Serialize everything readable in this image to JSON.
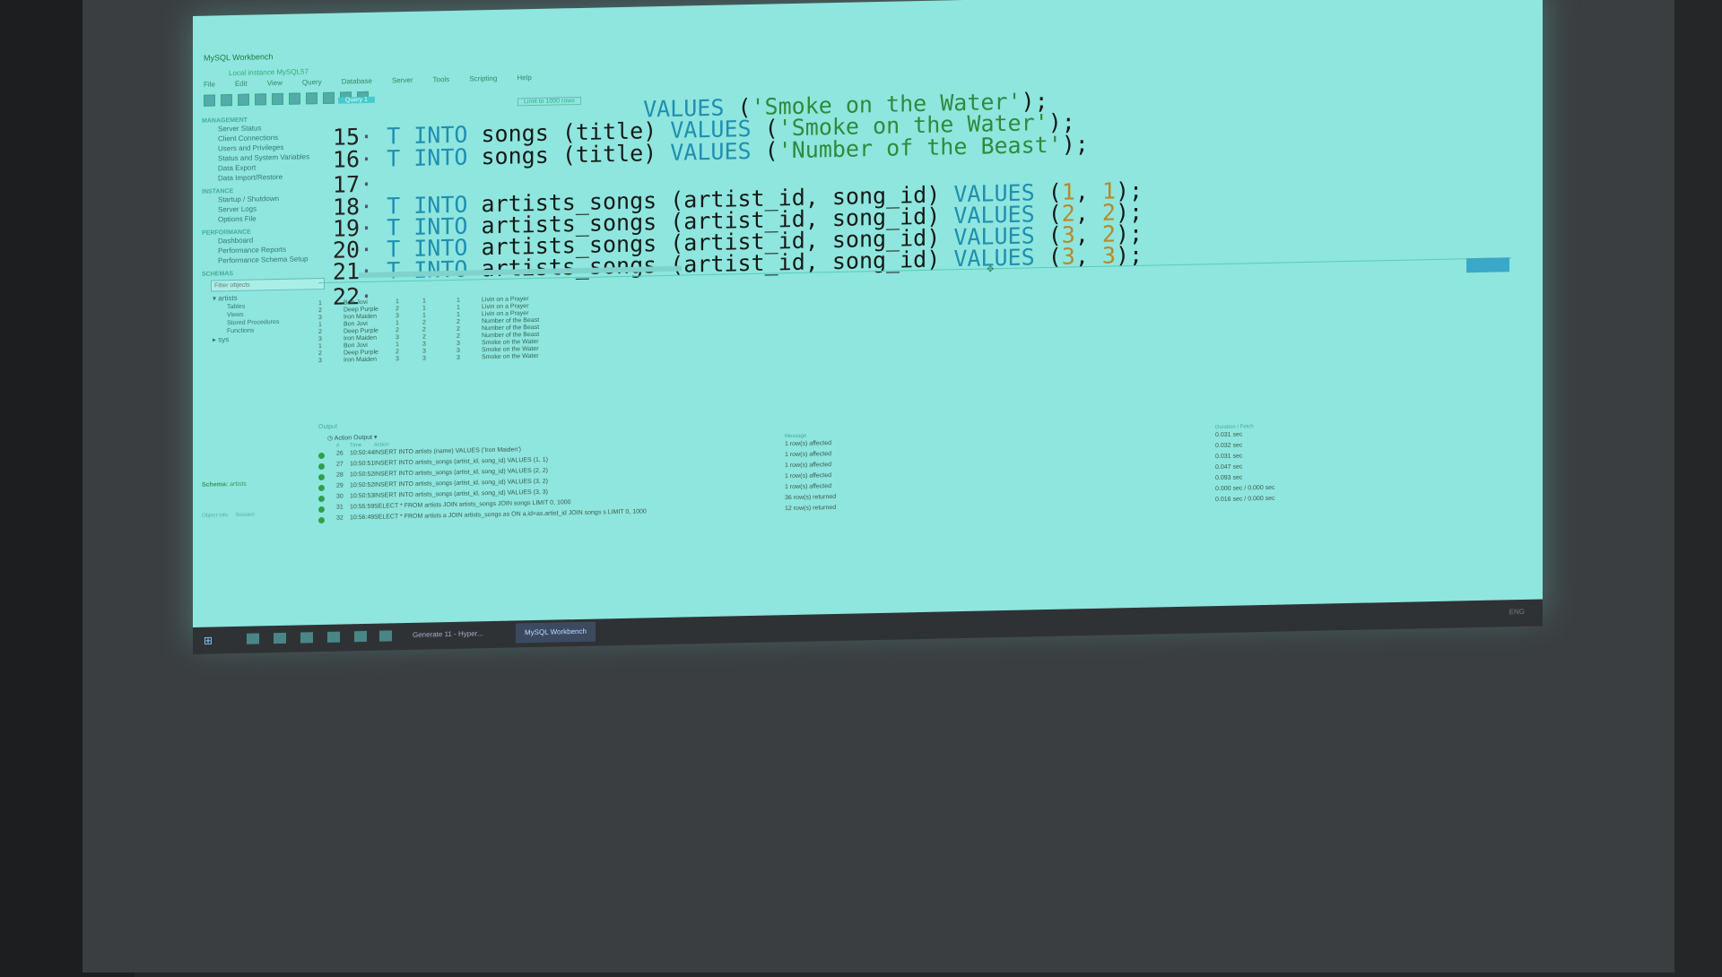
{
  "window": {
    "title": "MySQL Workbench",
    "connection_tab": "Local instance MySQL57",
    "controls": [
      "—",
      "□",
      "✕"
    ]
  },
  "menu": [
    "File",
    "Edit",
    "View",
    "Query",
    "Database",
    "Server",
    "Tools",
    "Scripting",
    "Help"
  ],
  "navigator": {
    "management_header": "MANAGEMENT",
    "management_items": [
      "Server Status",
      "Client Connections",
      "Users and Privileges",
      "Status and System Variables",
      "Data Export",
      "Data Import/Restore"
    ],
    "instance_header": "INSTANCE",
    "instance_items": [
      "Startup / Shutdown",
      "Server Logs",
      "Options File"
    ],
    "performance_header": "PERFORMANCE",
    "performance_items": [
      "Dashboard",
      "Performance Reports",
      "Performance Schema Setup"
    ],
    "schemas_header": "SCHEMAS",
    "filter_placeholder": "Filter objects",
    "schema_name": "artists",
    "schema_children": [
      "Tables",
      "Views",
      "Stored Procedures",
      "Functions"
    ],
    "other_schema": "sys",
    "schema_label": "Schema:",
    "schema_value": "artists"
  },
  "editor": {
    "tab": "Query 1",
    "limit": "Limit to 1000 rows",
    "lines": [
      {
        "no": "",
        "head": "",
        "table": "",
        "cols": "",
        "values_kw": "VALUES",
        "args": [
          "'Smoke on the Water'"
        ],
        "tail": ");"
      },
      {
        "no": "15",
        "head": "T INTO",
        "table": "songs",
        "cols": "(title)",
        "values_kw": "VALUES",
        "args": [
          "'Smoke on the Water'"
        ],
        "tail": ");"
      },
      {
        "no": "16",
        "head": "T INTO",
        "table": "songs",
        "cols": "(title)",
        "values_kw": "VALUES",
        "args": [
          "'Number of the Beast'"
        ],
        "tail": ");"
      },
      {
        "no": "17"
      },
      {
        "no": "18",
        "head": "T INTO",
        "table": "artists_songs",
        "cols": "(artist_id, song_id)",
        "values_kw": "VALUES",
        "a": "1",
        "b": "1"
      },
      {
        "no": "19",
        "head": "T INTO",
        "table": "artists_songs",
        "cols": "(artist_id, song_id)",
        "values_kw": "VALUES",
        "a": "2",
        "b": "2"
      },
      {
        "no": "20",
        "head": "T INTO",
        "table": "artists_songs",
        "cols": "(artist_id, song_id)",
        "values_kw": "VALUES",
        "a": "3",
        "b": "2"
      },
      {
        "no": "21",
        "head": "T INTO",
        "table": "artists_songs",
        "cols": "(artist_id, song_id)",
        "values_kw": "VALUES",
        "a": "3",
        "b": "3"
      },
      {
        "no": "22"
      }
    ]
  },
  "result_grid": {
    "rows": [
      [
        "1",
        "Bon Jovi",
        "1",
        "1",
        "1",
        "Livin on a Prayer"
      ],
      [
        "2",
        "Deep Purple",
        "2",
        "1",
        "1",
        "Livin on a Prayer"
      ],
      [
        "3",
        "Iron Maiden",
        "3",
        "1",
        "1",
        "Livin on a Prayer"
      ],
      [
        "1",
        "Bon Jovi",
        "1",
        "2",
        "2",
        "Number of the Beast"
      ],
      [
        "2",
        "Deep Purple",
        "2",
        "2",
        "2",
        "Number of the Beast"
      ],
      [
        "3",
        "Iron Maiden",
        "3",
        "2",
        "2",
        "Number of the Beast"
      ],
      [
        "1",
        "Bon Jovi",
        "1",
        "3",
        "3",
        "Smoke on the Water"
      ],
      [
        "2",
        "Deep Purple",
        "2",
        "3",
        "3",
        "Smoke on the Water"
      ],
      [
        "3",
        "Iron Maiden",
        "3",
        "3",
        "3",
        "Smoke on the Water"
      ]
    ]
  },
  "output": {
    "label": "Output",
    "selector": "Action Output",
    "headers": {
      "num": "#",
      "time": "Time",
      "action": "Action",
      "message": "Message",
      "duration": "Duration / Fetch"
    },
    "rows": [
      {
        "num": "26",
        "time": "10:50:44",
        "action": "INSERT INTO artists (name) VALUES ('Iron Maiden')",
        "message": "1 row(s) affected",
        "duration": "0.031 sec"
      },
      {
        "num": "27",
        "time": "10:50:51",
        "action": "INSERT INTO artists_songs (artist_id, song_id) VALUES (1, 1)",
        "message": "1 row(s) affected",
        "duration": "0.032 sec"
      },
      {
        "num": "28",
        "time": "10:50:52",
        "action": "INSERT INTO artists_songs (artist_id, song_id) VALUES (2, 2)",
        "message": "1 row(s) affected",
        "duration": "0.031 sec"
      },
      {
        "num": "29",
        "time": "10:50:52",
        "action": "INSERT INTO artists_songs (artist_id, song_id) VALUES (3, 2)",
        "message": "1 row(s) affected",
        "duration": "0.047 sec"
      },
      {
        "num": "30",
        "time": "10:50:53",
        "action": "INSERT INTO artists_songs (artist_id, song_id) VALUES (3, 3)",
        "message": "1 row(s) affected",
        "duration": "0.093 sec"
      },
      {
        "num": "31",
        "time": "10:55:59",
        "action": "SELECT * FROM artists JOIN artists_songs JOIN songs LIMIT 0, 1000",
        "message": "36 row(s) returned",
        "duration": "0.000 sec / 0.000 sec"
      },
      {
        "num": "32",
        "time": "10:56:49",
        "action": "SELECT * FROM artists a JOIN artists_songs as ON a.id=as.artist_id JOIN songs s LIMIT 0, 1000",
        "message": "12 row(s) returned",
        "duration": "0.016 sec / 0.000 sec"
      }
    ]
  },
  "status_bar": {
    "left": "Object Info",
    "right": "Session"
  },
  "taskbar": {
    "apps": [
      {
        "label": "Generate 11 - Hyper...",
        "active": false
      },
      {
        "label": "MySQL Workbench",
        "active": true
      }
    ],
    "tray": "ENG"
  },
  "colors": {
    "projection": "#8fe6de",
    "keyword": "#1f8fb0",
    "string": "#2f8a3c",
    "number": "#b7892a"
  }
}
